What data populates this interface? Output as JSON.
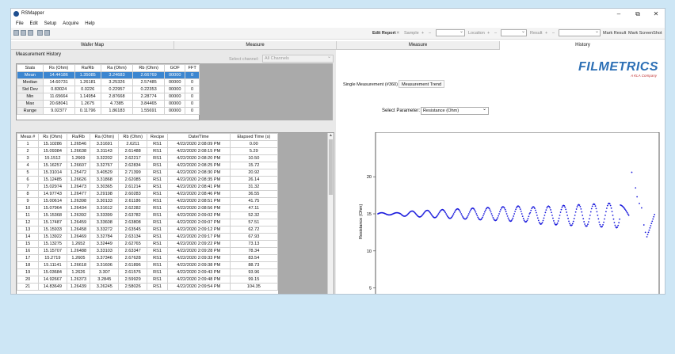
{
  "window": {
    "title": "RSMapper",
    "minimize": "–",
    "restore": "⧉",
    "close": "✕"
  },
  "menu": [
    "File",
    "Edit",
    "Setup",
    "Acquire",
    "Help"
  ],
  "toolbar": {
    "edit_report": "Edit Report",
    "close_glyph": "✕",
    "sample": "Sample",
    "location": "Location",
    "result": "Result",
    "plus": "+",
    "minus": "–",
    "mark_result": "Mark Result",
    "mark_screenshot": "Mark ScreenShot"
  },
  "main_tabs": [
    "Wafer Map",
    "Measure",
    "Measure",
    "History"
  ],
  "left": {
    "section_label": "Measurement History",
    "channel_label": "Select channel:",
    "channel_value": "All Channels"
  },
  "stats": {
    "headers": [
      "Stats",
      "Rs (Ohm)",
      "Ra/Rb",
      "Ra (Ohm)",
      "Rb (Ohm)",
      "GOF",
      "FFT"
    ],
    "rows": [
      [
        "Mean",
        "14.44186",
        "1.35085",
        "3.24683",
        "2.66769",
        "00000",
        "0"
      ],
      [
        "Median",
        "14.60731",
        "1.26181",
        "3.25326",
        "2.57485",
        "00000",
        "0"
      ],
      [
        "Std Dev",
        "0.83024",
        "0.0226",
        "0.22957",
        "0.22353",
        "00000",
        "0"
      ],
      [
        "Min",
        "11.65664",
        "1.14954",
        "2.87668",
        "2.28774",
        "00000",
        "0"
      ],
      [
        "Max",
        "20.68041",
        "1.2675",
        "4.7385",
        "3.84465",
        "00000",
        "0"
      ],
      [
        "Range",
        "9.02377",
        "0.11796",
        "1.86183",
        "1.55691",
        "00000",
        "0"
      ]
    ]
  },
  "measurements": {
    "headers": [
      "Meas #",
      "Rs (Ohm)",
      "Ra/Rb",
      "Ra (Ohm)",
      "Rb (Ohm)",
      "Recipe",
      "Date/Time",
      "Elapsed Time (s)"
    ],
    "rows": [
      [
        "1",
        "15.10286",
        "1.26546",
        "3.31691",
        "2.6211",
        "RS1",
        "4/22/2020 2:08:09 PM",
        "0.00"
      ],
      [
        "2",
        "15.09384",
        "1.26638",
        "3.31143",
        "2.61488",
        "RS1",
        "4/22/2020 2:08:15 PM",
        "5.29"
      ],
      [
        "3",
        "15.1512",
        "1.2669",
        "3.32202",
        "2.62217",
        "RS1",
        "4/22/2020 2:08:20 PM",
        "10.50"
      ],
      [
        "4",
        "15.16257",
        "1.26607",
        "3.32767",
        "2.62834",
        "RS1",
        "4/22/2020 2:08:25 PM",
        "15.72"
      ],
      [
        "5",
        "15.31014",
        "1.25472",
        "3.40529",
        "2.71399",
        "RS1",
        "4/22/2020 2:08:30 PM",
        "20.92"
      ],
      [
        "6",
        "15.12485",
        "1.26626",
        "3.31868",
        "2.62085",
        "RS1",
        "4/22/2020 2:08:35 PM",
        "26.14"
      ],
      [
        "7",
        "15.02974",
        "1.26473",
        "3.30365",
        "2.61214",
        "RS1",
        "4/22/2020 2:08:41 PM",
        "31.32"
      ],
      [
        "8",
        "14.97743",
        "1.26477",
        "3.29198",
        "2.60283",
        "RS1",
        "4/22/2020 2:08:46 PM",
        "36.55"
      ],
      [
        "9",
        "15.00614",
        "1.26398",
        "3.30133",
        "2.61186",
        "RS1",
        "4/22/2020 2:08:51 PM",
        "41.75"
      ],
      [
        "10",
        "15.07964",
        "1.26434",
        "3.31612",
        "2.62282",
        "RS1",
        "4/22/2020 2:08:56 PM",
        "47.11"
      ],
      [
        "11",
        "15.15368",
        "1.26392",
        "3.33399",
        "2.63782",
        "RS1",
        "4/22/2020 2:09:02 PM",
        "52.32"
      ],
      [
        "12",
        "15.17487",
        "1.26459",
        "3.33608",
        "2.63808",
        "RS1",
        "4/22/2020 2:09:07 PM",
        "57.51"
      ],
      [
        "13",
        "15.15933",
        "1.26458",
        "3.33272",
        "2.63545",
        "RS1",
        "4/22/2020 2:09:12 PM",
        "62.72"
      ],
      [
        "14",
        "15.13922",
        "1.26469",
        "3.32784",
        "2.63134",
        "RS1",
        "4/22/2020 2:09:17 PM",
        "67.93"
      ],
      [
        "15",
        "15.13275",
        "1.2652",
        "3.32449",
        "2.62765",
        "RS1",
        "4/22/2020 2:09:22 PM",
        "73.13"
      ],
      [
        "16",
        "15.15707",
        "1.26488",
        "3.33103",
        "2.63347",
        "RS1",
        "4/22/2020 2:09:28 PM",
        "78.34"
      ],
      [
        "17",
        "15.2719",
        "1.2605",
        "3.37346",
        "2.67628",
        "RS1",
        "4/22/2020 2:09:33 PM",
        "83.54"
      ],
      [
        "18",
        "15.11141",
        "1.26618",
        "3.31606",
        "2.61896",
        "RS1",
        "4/22/2020 2:09:38 PM",
        "88.73"
      ],
      [
        "19",
        "15.03684",
        "1.2626",
        "3.307",
        "2.61576",
        "RS1",
        "4/22/2020 2:09:43 PM",
        "93.96"
      ],
      [
        "20",
        "14.92667",
        "1.26373",
        "3.2845",
        "2.59929",
        "RS1",
        "4/22/2020 2:09:48 PM",
        "99.15"
      ],
      [
        "21",
        "14.83649",
        "1.26439",
        "3.26245",
        "2.58026",
        "RS1",
        "4/22/2020 2:09:54 PM",
        "104.35"
      ]
    ]
  },
  "right": {
    "logo": "FILMETRICS",
    "logo_sub": "A KLA Company",
    "subtabs": [
      "Single Measurement (#360)",
      "Measurement Trend"
    ],
    "select_param_label": "Select Parameter:",
    "select_param_value": "Resistance (Ohm)"
  },
  "chart_data": {
    "type": "scatter",
    "title": "",
    "xlabel": "",
    "ylabel": "Resistance (Ohm)",
    "ylim": [
      4,
      26
    ],
    "yticks": [
      5,
      10,
      15,
      20
    ],
    "grid": false,
    "series": [
      {
        "description": "oscillating resistance trend around 15 Ohm, amplitude growing over time, with outliers up to about 20.7 near the end"
      }
    ],
    "color": "#1a1adc",
    "n_points": 360,
    "outliers": [
      [
        335,
        20.6
      ],
      [
        340,
        18.5
      ],
      [
        342,
        17.3
      ],
      [
        345,
        16.4
      ],
      [
        348,
        15.8
      ],
      [
        351,
        13.5
      ],
      [
        353,
        12.5
      ],
      [
        355,
        11.9
      ]
    ]
  }
}
